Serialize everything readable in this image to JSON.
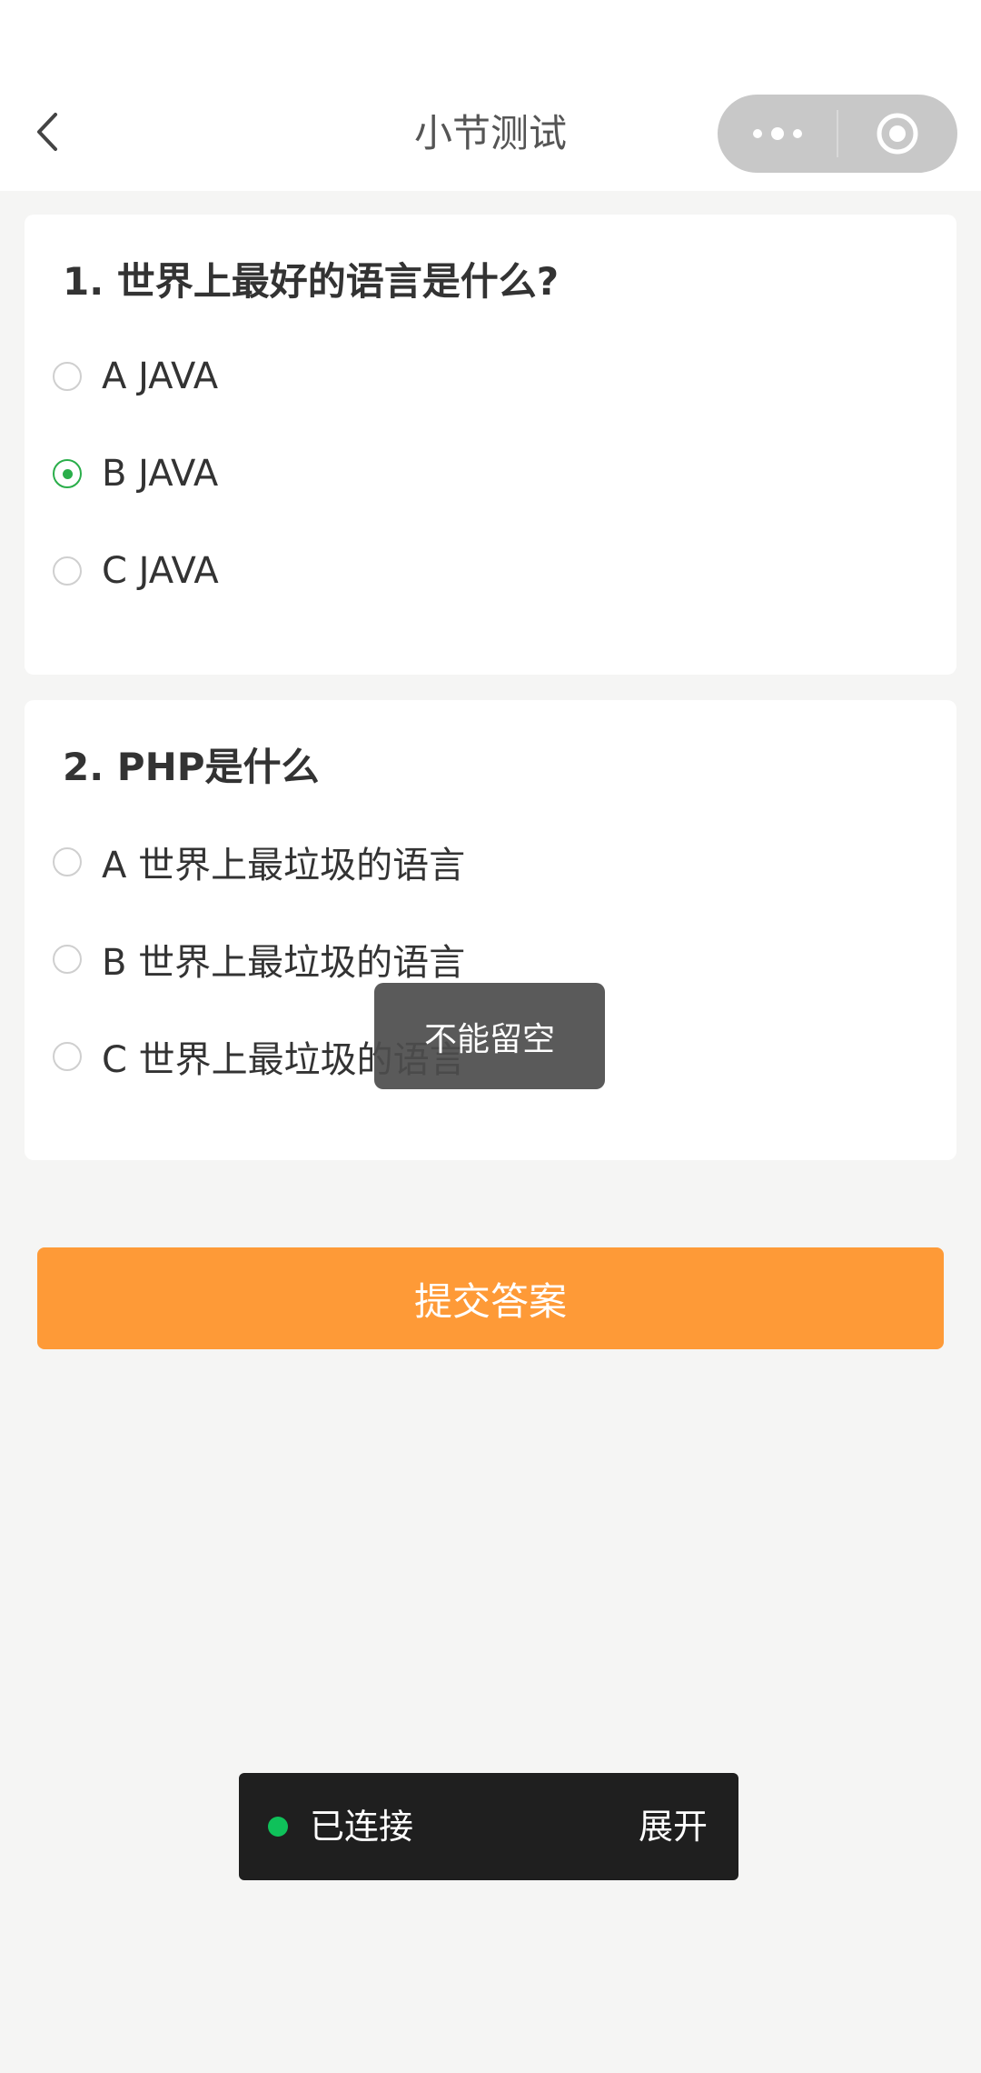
{
  "navbar": {
    "title": "小节测试",
    "back_icon": "chevron-left-icon",
    "capsule": {
      "menu_icon": "more-dots-icon",
      "close_icon": "target-circle-icon"
    }
  },
  "questions": [
    {
      "title": "1. 世界上最好的语言是什么?",
      "options": [
        {
          "label": "A JAVA",
          "checked": false
        },
        {
          "label": "B JAVA",
          "checked": true
        },
        {
          "label": "C JAVA",
          "checked": false
        }
      ]
    },
    {
      "title": "2. PHP是什么",
      "options": [
        {
          "label": "A 世界上最垃圾的语言",
          "checked": false
        },
        {
          "label": "B 世界上最垃圾的语言",
          "checked": false
        },
        {
          "label": "C 世界上最垃圾的语言",
          "checked": false
        }
      ]
    }
  ],
  "submit": {
    "label": "提交答案",
    "color": "#fe9a37"
  },
  "toast": {
    "message": "不能留空"
  },
  "connection": {
    "status": "已连接",
    "expand_label": "展开",
    "status_color": "#0fc15a"
  },
  "colors": {
    "radio_checked": "#2aae4a",
    "background": "#f5f5f4"
  }
}
